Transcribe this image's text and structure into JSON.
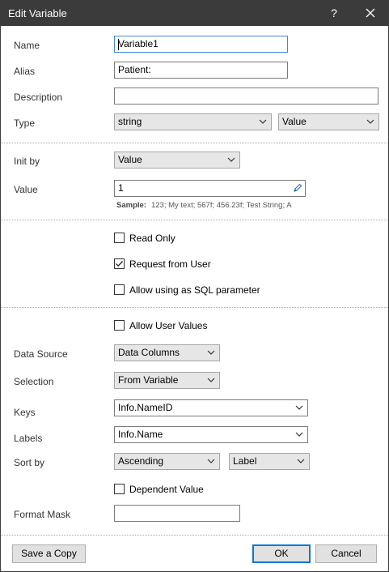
{
  "window": {
    "title": "Edit Variable",
    "help_label": "?"
  },
  "fields": {
    "name": {
      "label": "Name",
      "value": "Variable1"
    },
    "alias": {
      "label": "Alias",
      "value": "Patient:"
    },
    "description": {
      "label": "Description",
      "value": ""
    },
    "type": {
      "label": "Type",
      "value": "string",
      "kind": "Value"
    },
    "init_by": {
      "label": "Init by",
      "value": "Value"
    },
    "value": {
      "label": "Value",
      "value": "1"
    },
    "sample": {
      "label": "Sample:",
      "text": "123; My text; 567f; 456.23f; Test String; A"
    }
  },
  "checkboxes": {
    "read_only": {
      "label": "Read Only",
      "checked": false
    },
    "request_from_user": {
      "label": "Request from User",
      "checked": true
    },
    "allow_sql": {
      "label": "Allow using as SQL parameter",
      "checked": false
    },
    "allow_user_values": {
      "label": "Allow User Values",
      "checked": false
    },
    "dependent_value": {
      "label": "Dependent Value",
      "checked": false
    }
  },
  "request": {
    "data_source": {
      "label": "Data Source",
      "value": "Data Columns"
    },
    "selection": {
      "label": "Selection",
      "value": "From Variable"
    },
    "keys": {
      "label": "Keys",
      "value": "Info.NameID"
    },
    "labels": {
      "label": "Labels",
      "value": "Info.Name"
    },
    "sort_by": {
      "label": "Sort by",
      "order": "Ascending",
      "field": "Label"
    },
    "format_mask": {
      "label": "Format Mask",
      "value": ""
    }
  },
  "buttons": {
    "save_copy": "Save a Copy",
    "ok": "OK",
    "cancel": "Cancel"
  },
  "colors": {
    "titlebar": "#3b3b3b",
    "focus_border": "#3e8bd6",
    "default_button_border": "#0078d7"
  },
  "icons": {
    "close": "close-icon",
    "chevron": "chevron-down-icon",
    "edit": "pencil-icon",
    "check": "checkmark-icon"
  }
}
